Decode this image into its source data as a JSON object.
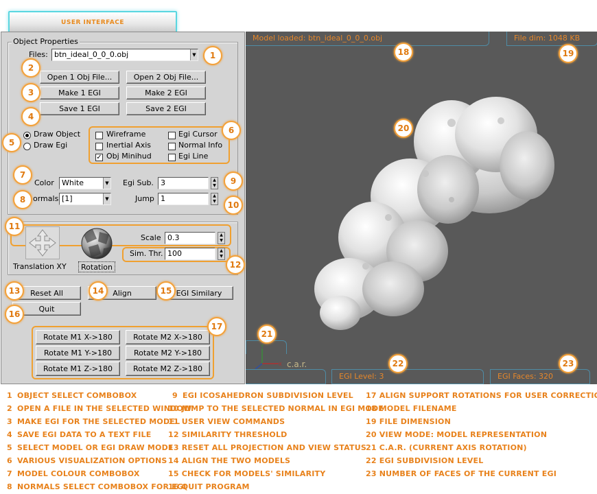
{
  "title": "USER INTERFACE",
  "panel": {
    "object_properties": "Object Properties",
    "files_label": "Files:",
    "files_value": "btn_ideal_0_0_0.obj",
    "buttons": {
      "open1": "Open 1 Obj File...",
      "open2": "Open 2 Obj File...",
      "make1": "Make 1 EGI",
      "make2": "Make 2 EGI",
      "save1": "Save 1 EGI",
      "save2": "Save 2 EGI"
    },
    "draw_object": "Draw Object",
    "draw_egi": "Draw Egi",
    "options": {
      "wireframe": "Wireframe",
      "egi_cursor": "Egi Cursor",
      "inertial_axis": "Inertial Axis",
      "normal_info": "Normal Info",
      "obj_minihud": "Obj Minihud",
      "egi_line": "Egi Line"
    },
    "checked": {
      "wireframe": false,
      "egi_cursor": false,
      "inertial_axis": false,
      "normal_info": false,
      "obj_minihud": true,
      "egi_line": false
    },
    "color_label": "Color",
    "color_value": "White",
    "normals_label": "ormals",
    "normals_value": "[1]",
    "egi_sub_label": "Egi Sub.",
    "egi_sub_value": "3",
    "jump_label": "Jump",
    "jump_value": "1",
    "translation_label": "Translation XY",
    "rotation_label": "Rotation",
    "scale_label": "Scale",
    "scale_value": "0.3",
    "sim_label": "Sim. Thr.",
    "sim_value": "100",
    "reset_all": "Reset All",
    "align": "Align",
    "egi_similary": "EGI Similary",
    "quit": "Quit",
    "rot": {
      "m1x": "Rotate M1 X->180",
      "m2x": "Rotate M2 X->180",
      "m1y": "Rotate M1 Y->180",
      "m2y": "Rotate M2 Y->180",
      "m1z": "Rotate M1 Z->180",
      "m2z": "Rotate M2 Z->180"
    }
  },
  "view": {
    "model_loaded": "Model loaded: btn_ideal_0_0_0.obj",
    "file_dim": "File dim: 1048 KB",
    "car_label": "c.a.r.",
    "egi_level": "EGI Level: 3",
    "egi_faces": "EGI Faces: 320"
  },
  "badges": [
    "1",
    "2",
    "3",
    "4",
    "5",
    "6",
    "7",
    "8",
    "9",
    "10",
    "11",
    "12",
    "13",
    "14",
    "15",
    "16",
    "17",
    "18",
    "19",
    "20",
    "21",
    "22",
    "23"
  ],
  "legend": [
    {
      "n": "1",
      "text": "OBJECT SELECT COMBOBOX"
    },
    {
      "n": "2",
      "text": "OPEN A FILE IN THE SELECTED WINDOW"
    },
    {
      "n": "3",
      "text": "MAKE EGI FOR THE SELECTED MODEL"
    },
    {
      "n": "4",
      "text": "SAVE EGI DATA TO A TEXT FILE"
    },
    {
      "n": "5",
      "text": "SELECT MODEL OR EGI DRAW MODE"
    },
    {
      "n": "6",
      "text": "VARIOUS VISUALIZATION OPTIONS"
    },
    {
      "n": "7",
      "text": "MODEL COLOUR COMBOBOX"
    },
    {
      "n": "8",
      "text": "NORMALS SELECT COMBOBOX FOR EGI"
    },
    {
      "n": "9",
      "text": "EGI ICOSAHEDRON SUBDIVISION LEVEL"
    },
    {
      "n": "10",
      "text": "JUMP TO THE SELECTED NORMAL IN EGI MODE"
    },
    {
      "n": "11",
      "text": "USER VIEW COMMANDS"
    },
    {
      "n": "12",
      "text": "SIMILARITY THRESHOLD"
    },
    {
      "n": "13",
      "text": "RESET ALL PROJECTION AND VIEW STATUS"
    },
    {
      "n": "14",
      "text": "ALIGN THE TWO MODELS"
    },
    {
      "n": "15",
      "text": "CHECK FOR MODELS' SIMILARITY"
    },
    {
      "n": "16",
      "text": "QUIT PROGRAM"
    },
    {
      "n": "17",
      "text": "ALIGN SUPPORT ROTATIONS FOR USER CORRECTION"
    },
    {
      "n": "18",
      "text": "MODEL FILENAME"
    },
    {
      "n": "19",
      "text": "FILE DIMENSION"
    },
    {
      "n": "20",
      "text": "VIEW MODE: MODEL REPRESENTATION"
    },
    {
      "n": "21",
      "text": "C.A.R. (CURRENT AXIS ROTATION)"
    },
    {
      "n": "22",
      "text": "EGI SUBDIVISION LEVEL"
    },
    {
      "n": "23",
      "text": "NUMBER OF FACES OF THE CURRENT EGI"
    }
  ],
  "colors": {
    "accent": "#e8821c",
    "badge_border": "#f3a13a",
    "view_bg": "#595959",
    "tab_border": "#4e8ca6"
  }
}
